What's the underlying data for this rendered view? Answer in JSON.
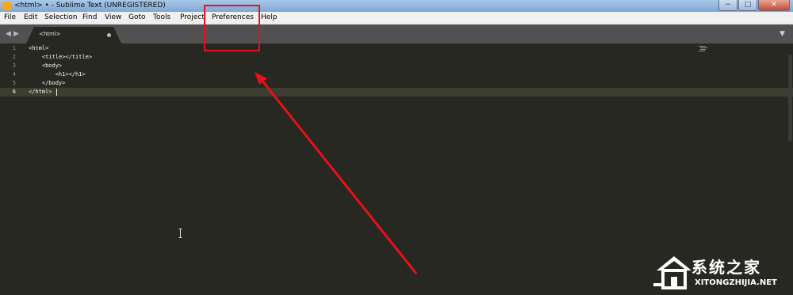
{
  "window": {
    "title": "<html> • - Sublime Text (UNREGISTERED)",
    "controls": {
      "minimize": "−",
      "maximize": "□",
      "close": "✕"
    }
  },
  "menubar": {
    "items": [
      "File",
      "Edit",
      "Selection",
      "Find",
      "View",
      "Goto",
      "Tools",
      "Project",
      "Preferences",
      "Help"
    ]
  },
  "tabs": [
    {
      "label": "<html>",
      "modified": true
    }
  ],
  "nav": {
    "back": "◀",
    "forward": "▶",
    "tab_menu": "▼"
  },
  "editor": {
    "line_numbers": [
      "1",
      "2",
      "3",
      "4",
      "5",
      "6"
    ],
    "lines": [
      "<html>",
      "    <title></title>",
      "    <body>",
      "        <h1></h1>",
      "    </body>",
      "</html>"
    ],
    "current_line": 6
  },
  "annotation": {
    "highlight_color": "#e8101a",
    "target_menu": "Preferences"
  },
  "watermark": {
    "name": "系统之家",
    "domain": "XITONGZHIJIA.NET"
  },
  "colors": {
    "editor_bg": "#272822",
    "tabbar_bg": "#515151",
    "menubar_bg": "#f0f0f0",
    "text": "#f8f8f2",
    "gutter": "#8f908a"
  }
}
